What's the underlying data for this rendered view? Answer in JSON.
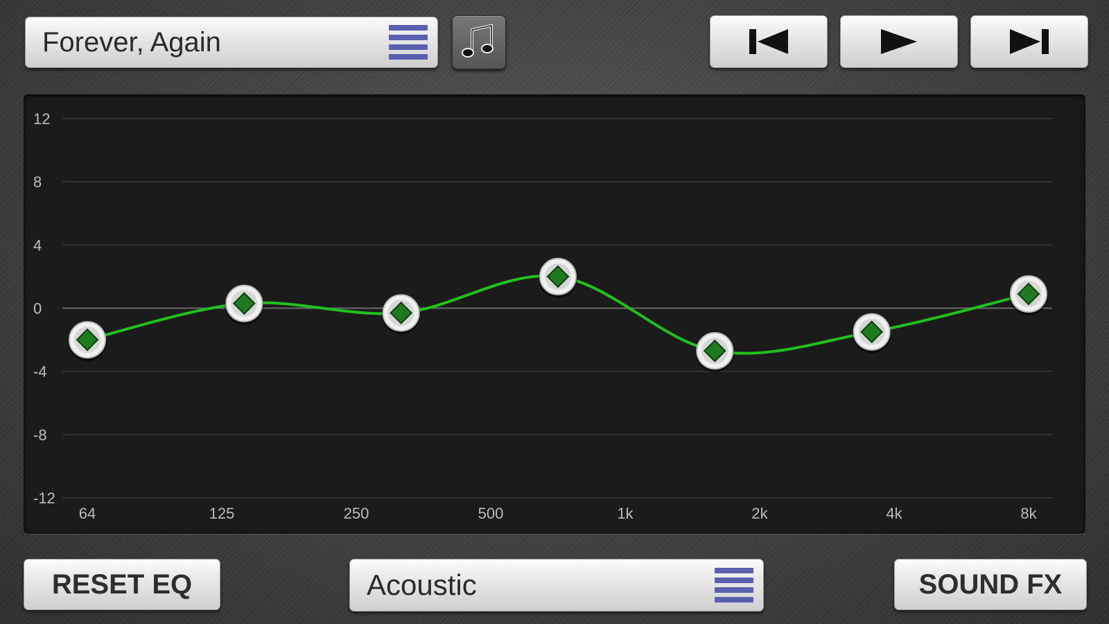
{
  "track": {
    "title": "Forever, Again",
    "menu_icon": "list-icon"
  },
  "music_library_icon": "music-note-icon",
  "transport": {
    "previous_icon": "skip-back-icon",
    "play_icon": "play-icon",
    "next_icon": "skip-forward-icon"
  },
  "chart_data": {
    "type": "line",
    "y_ticks": [
      "12",
      "8",
      "4",
      "0",
      "-4",
      "-8",
      "-12"
    ],
    "ylim": [
      -12,
      12
    ],
    "categories": [
      "64",
      "125",
      "250",
      "500",
      "1k",
      "2k",
      "4k",
      "8k"
    ],
    "series": [
      {
        "gains": [
          -2,
          0.3,
          -0.3,
          2,
          -2.7,
          -1.5,
          0.9
        ]
      }
    ],
    "line_color": "#22c01c",
    "handle_color": "#1f7a1f",
    "grid": true
  },
  "buttons": {
    "reset_eq": "RESET EQ",
    "sound_fx": "SOUND FX"
  },
  "preset": {
    "value": "Acoustic",
    "menu_icon": "list-icon"
  }
}
